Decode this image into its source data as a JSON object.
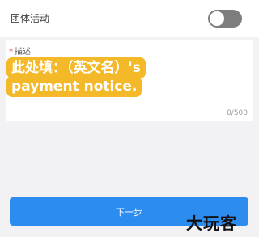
{
  "toggle_row": {
    "label": "团体活动",
    "toggle_on": false
  },
  "description": {
    "required_mark": "*",
    "label": "描述",
    "text": "此处填：（英文名）'s payment notice.",
    "counter": "0/500"
  },
  "footer": {
    "next_label": "下一步"
  },
  "watermark": {
    "text": "大玩客"
  },
  "colors": {
    "accent": "#2d8cf0",
    "highlight": "#f4b928",
    "toggle_off": "#7d7d7d"
  }
}
